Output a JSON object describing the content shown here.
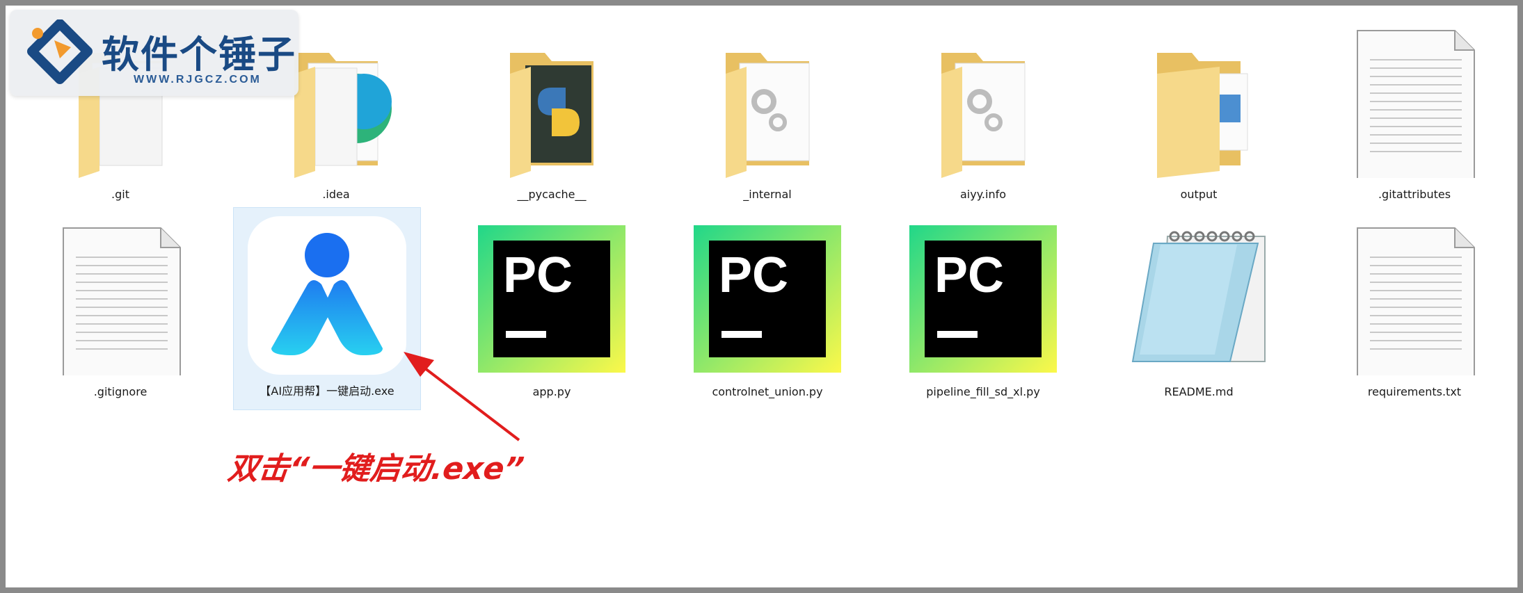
{
  "logo": {
    "title": "软件个锤子",
    "url": "WWW.RJGCZ.COM"
  },
  "files_row1": [
    {
      "name": ".git",
      "icon": "folder-icon"
    },
    {
      "name": ".idea",
      "icon": "folder-idea-icon"
    },
    {
      "name": "__pycache__",
      "icon": "folder-python-icon"
    },
    {
      "name": "_internal",
      "icon": "folder-gears-icon"
    },
    {
      "name": "aiyy.info",
      "icon": "folder-gears-icon"
    },
    {
      "name": "output",
      "icon": "folder-image-icon"
    },
    {
      "name": ".gitattributes",
      "icon": "text-file-icon"
    }
  ],
  "files_row2": [
    {
      "name": ".gitignore",
      "icon": "text-file-icon"
    },
    {
      "name": "【AI应用帮】一键启动.exe",
      "icon": "app-exe-icon"
    },
    {
      "name": "app.py",
      "icon": "pycharm-file-icon"
    },
    {
      "name": "controlnet_union.py",
      "icon": "pycharm-file-icon"
    },
    {
      "name": "pipeline_fill_sd_xl.py",
      "icon": "pycharm-file-icon"
    },
    {
      "name": "README.md",
      "icon": "notepad-icon"
    },
    {
      "name": "requirements.txt",
      "icon": "text-file-icon"
    }
  ],
  "pycharm_badge": "PC",
  "annotation": "双击“一键启动.exe”",
  "colors": {
    "folder": "#f6d98a",
    "folder_dark": "#e8c062",
    "annotation_red": "#e11d1d",
    "app_blue": "#1e7cf0",
    "selection": "#e5f1fb"
  }
}
